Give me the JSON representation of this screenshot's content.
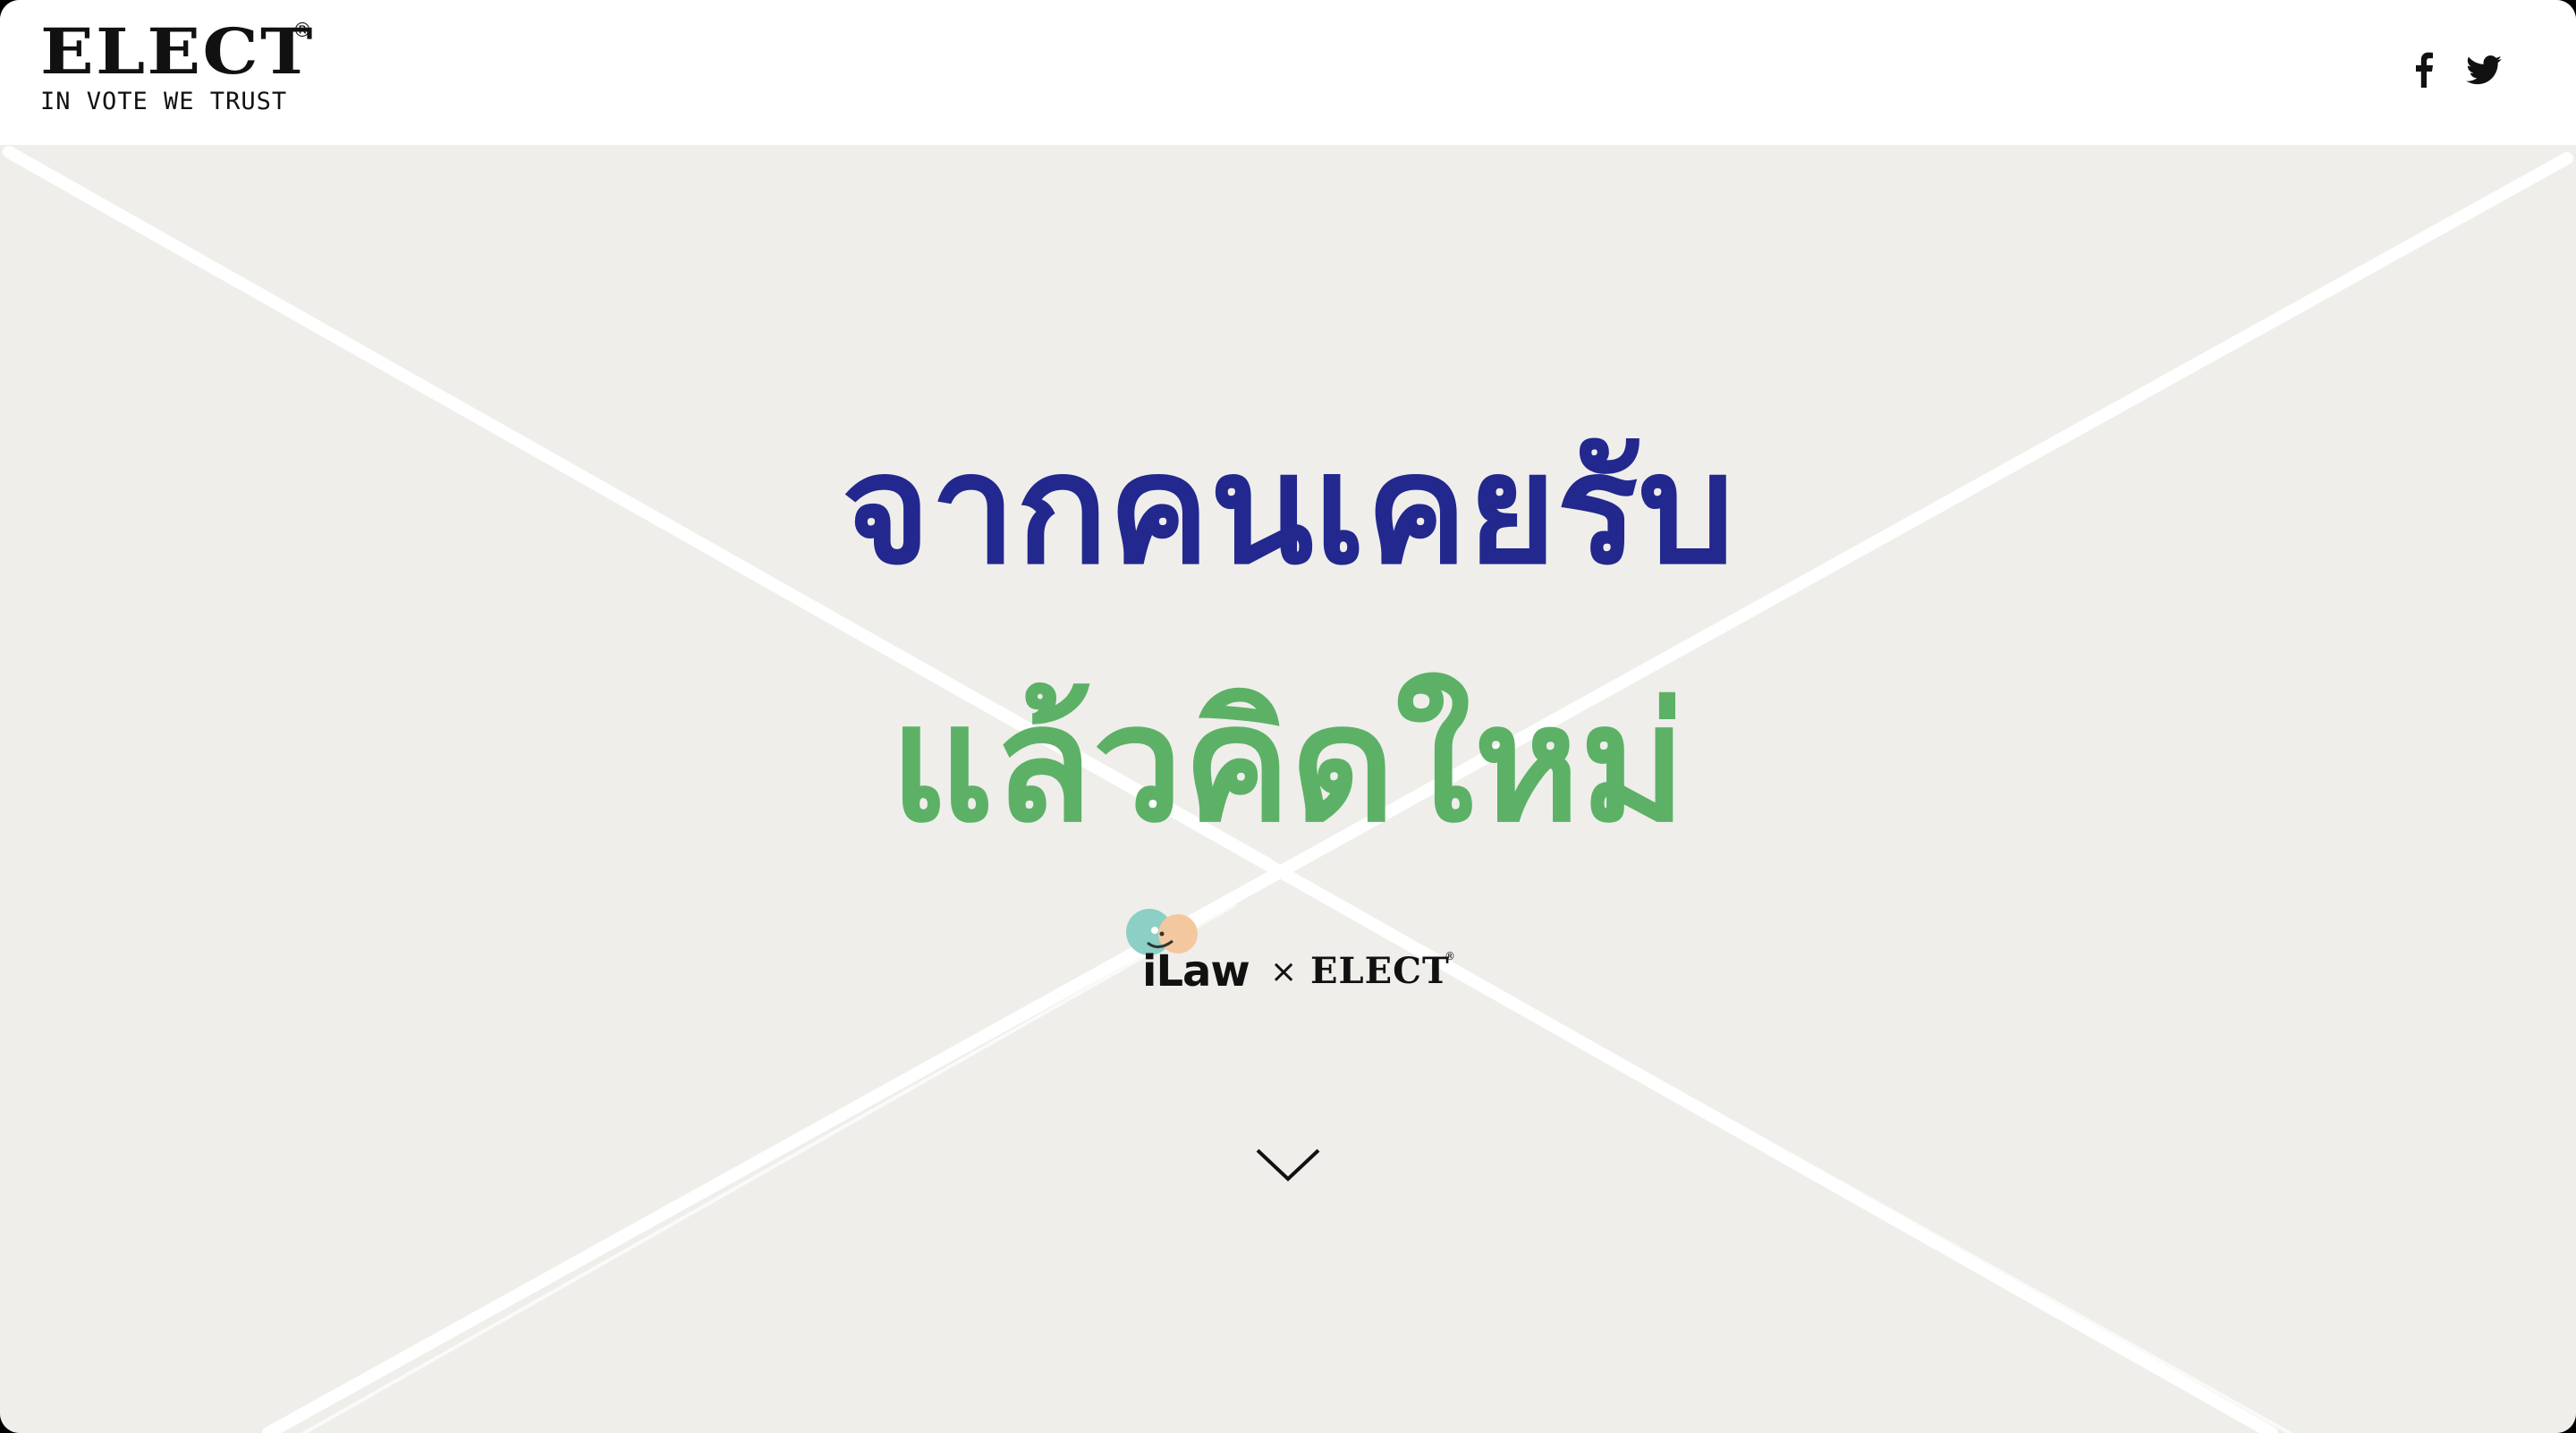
{
  "header": {
    "logo_text": "ELECT",
    "logo_registered": "®",
    "tagline": "IN VOTE WE TRUST",
    "social": [
      {
        "name": "facebook",
        "icon": "facebook-icon"
      },
      {
        "name": "twitter",
        "icon": "twitter-icon"
      }
    ]
  },
  "hero": {
    "title_line1": "จากคนเคยรับ",
    "title_line2": "แล้วคิดใหม่",
    "line1_color": "#22288e",
    "line2_color": "#5cb167",
    "background_color": "#efeeea"
  },
  "partner": {
    "ilaw_text": "iLaw",
    "times": "×",
    "elect_text": "ELECT",
    "elect_registered": "®"
  },
  "scroll": {
    "icon": "chevron-down-icon"
  }
}
